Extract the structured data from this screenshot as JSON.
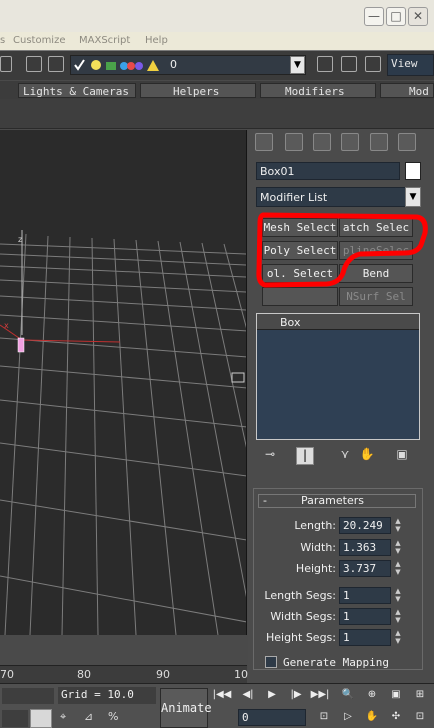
{
  "menu": [
    "s",
    "Customize",
    "MAXScript",
    "Help"
  ],
  "toolbar": {
    "layer_value": "0",
    "view_label": "View",
    "dropdown_glyph": "▼"
  },
  "tabs": [
    "Lights & Cameras",
    "Helpers",
    "Modifiers",
    "Mod"
  ],
  "object_name": "Box01",
  "modifier_list": "Modifier List",
  "modifier_buttons": {
    "mesh_select": "Mesh Select",
    "patch_select": "atch Selec",
    "poly_select": "Poly Select",
    "spline_select": "plineSelec",
    "vol_select": "ol. Select",
    "bend": "Bend",
    "blank": "",
    "nsurf_sel": "NSurf Sel"
  },
  "stack": {
    "item": "Box"
  },
  "parameters": {
    "header": "Parameters",
    "collapse": "-",
    "length_label": "Length:",
    "length_value": "20.249",
    "width_label": "Width:",
    "width_value": "1.363",
    "height_label": "Height:",
    "height_value": "3.737",
    "length_segs_label": "Length Segs:",
    "length_segs_value": "1",
    "width_segs_label": "Width Segs:",
    "width_segs_value": "1",
    "height_segs_label": "Height Segs:",
    "height_segs_value": "1",
    "generate_mapping": "Generate Mapping",
    "generate_mapping_checked": false
  },
  "viewport": {
    "axis_label": "z",
    "corner_label": "x"
  },
  "time_ruler": [
    "70",
    "80",
    "90",
    "10"
  ],
  "status_bar": {
    "grid_text": "Grid = 10.0",
    "animate_label": "Animate",
    "frame_value": "0"
  },
  "colors": {
    "highlight_outline": "#ff0000",
    "object_color": "#ffffff",
    "field_bg": "#2e3a47"
  },
  "window_buttons": [
    "—",
    "□",
    "✕"
  ]
}
